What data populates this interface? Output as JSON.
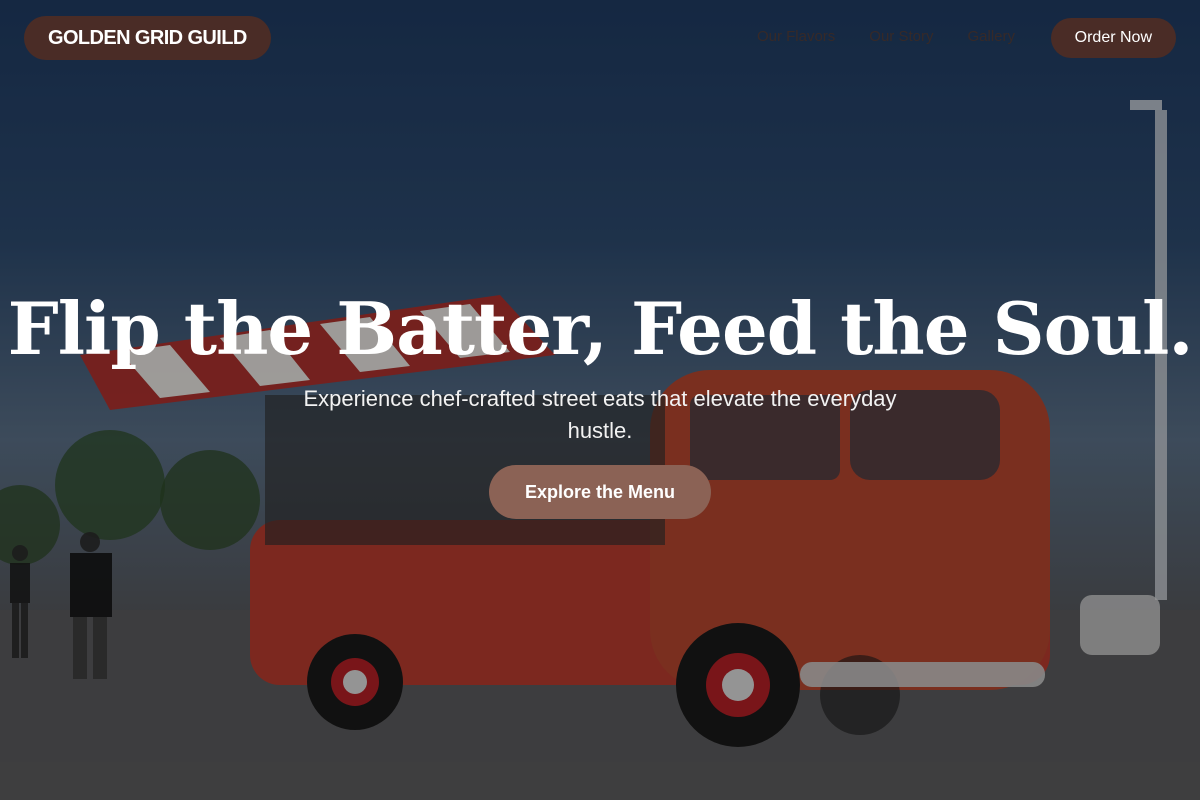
{
  "brand": {
    "name": "GOLDEN GRID GUILD"
  },
  "nav": {
    "links": [
      "Our Flavors",
      "Our Story",
      "Gallery"
    ],
    "order_label": "Order Now"
  },
  "hero": {
    "title": "Flip the Batter, Feed the Soul.",
    "subtitle": "Experience chef-crafted street eats that elevate the everyday hustle.",
    "cta_label": "Explore the Menu"
  },
  "colors": {
    "nav_button": "#4a2c26",
    "cta": "#8b6255",
    "text": "#ffffff"
  }
}
